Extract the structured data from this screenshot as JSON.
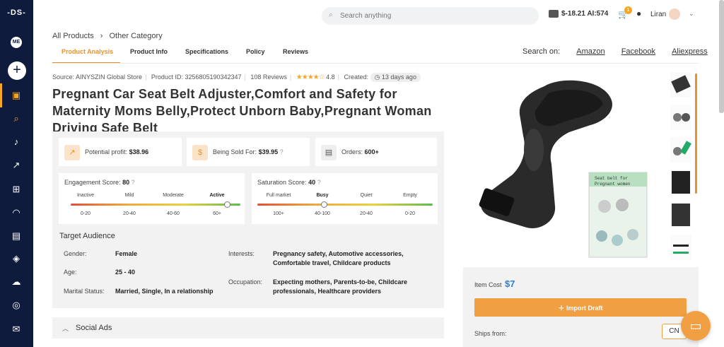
{
  "sidebar": {
    "logo": "-DS-",
    "avatar_initials": "ME",
    "add_label": "+"
  },
  "topbar": {
    "search_placeholder": "Search anything",
    "wallet": "$-18.21 AI:574",
    "cart_badge": "1",
    "user_name": "Liran"
  },
  "breadcrumb": {
    "root": "All Products",
    "separator": "›",
    "current": "Other Category"
  },
  "tabs": [
    "Product Analysis",
    "Product Info",
    "Specifications",
    "Policy",
    "Reviews"
  ],
  "search_on": {
    "label": "Search on:",
    "links": [
      "Amazon",
      "Facebook",
      "Aliexpress"
    ]
  },
  "meta": {
    "source": "Source: AINYSZIN Global Store",
    "product_id": "Product ID: 3256805190342347",
    "reviews": "108 Reviews",
    "stars": "★★★★☆",
    "rating": "4.8",
    "created_label": "Created:",
    "created_value": "13 days ago"
  },
  "product_title": "Pregnant Car Seat Belt Adjuster,Comfort and Safety for Maternity Moms Belly,Protect Unborn Baby,Pregnant Woman Driving Safe Belt",
  "stats": {
    "profit_label": "Potential profit:",
    "profit_value": "$38.96",
    "sold_label": "Being Sold For:",
    "sold_value": "$39.95",
    "orders_label": "Orders:",
    "orders_value": "600+"
  },
  "engagement": {
    "label": "Engagement Score:",
    "value": "80",
    "levels": [
      "Inactive",
      "Mild",
      "Moderate",
      "Active"
    ],
    "ranges": [
      "0-20",
      "20-40",
      "40-60",
      "60+"
    ],
    "position": 0.92
  },
  "saturation": {
    "label": "Saturation Score:",
    "value": "40",
    "levels": [
      "Full market",
      "Busy",
      "Quiet",
      "Empty"
    ],
    "ranges": [
      "100+",
      "40-100",
      "20-40",
      "0-20"
    ],
    "position": 0.38
  },
  "audience": {
    "title": "Target Audience",
    "gender_label": "Gender:",
    "gender_value": "Female",
    "age_label": "Age:",
    "age_value": "25 - 40",
    "marital_label": "Marital Status:",
    "marital_value": "Married, Single, In a relationship",
    "interests_label": "Interests:",
    "interests_value": "Pregnancy safety, Automotive accessories, Comfortable travel, Childcare products",
    "occupation_label": "Occupation:",
    "occupation_value": "Expecting mothers, Parents-to-be, Childcare professionals, Healthcare providers"
  },
  "social_ads": "Social Ads",
  "buybox": {
    "cost_label": "Item Cost",
    "cost_value": "$7",
    "import_label": "Import Draft",
    "ships_label": "Ships from:",
    "ships_value": "CN"
  },
  "image_card": {
    "line1": "Seat belt for",
    "line2": "Pregnant women"
  },
  "colors": {
    "accent": "#e8922e",
    "sidebar": "#0f1b3d",
    "link_blue": "#2a7de1"
  }
}
